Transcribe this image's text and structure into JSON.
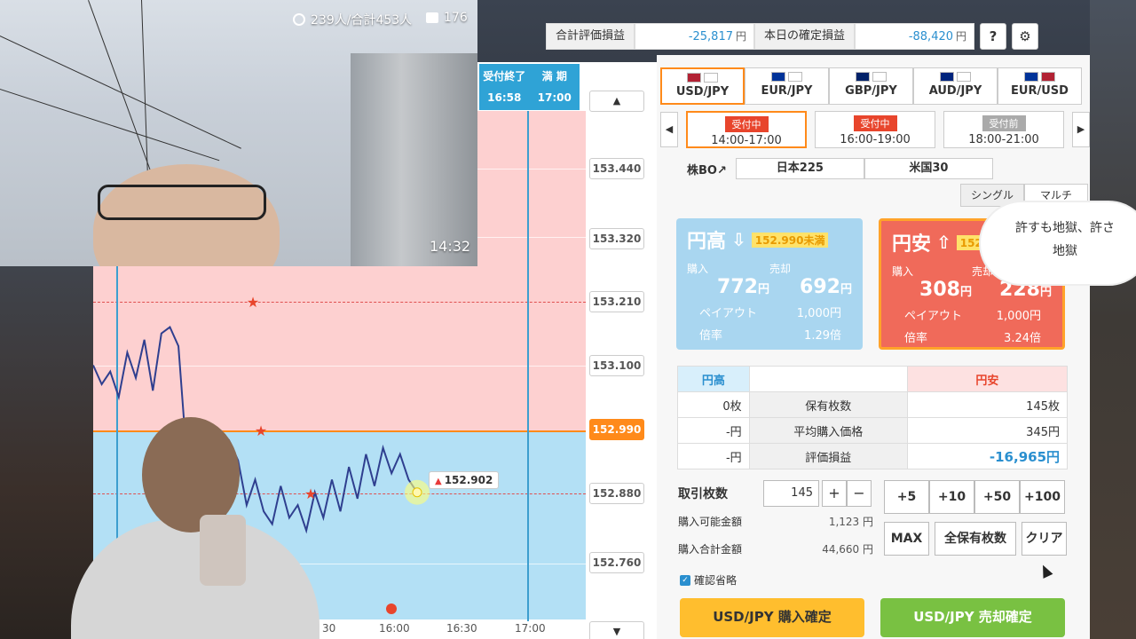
{
  "camera": {
    "viewers": "239人/合計453人",
    "comments": "176",
    "time": "14:32"
  },
  "topbar": {
    "total_eval_label": "合計評価損益",
    "total_eval_value": "-25,817",
    "today_confirmed_label": "本日の確定損益",
    "today_confirmed_value": "-88,420",
    "yen": "円",
    "help_label": "?",
    "settings_icon": "gear-icon"
  },
  "pairs": [
    {
      "label": "USD/JPY",
      "active": true
    },
    {
      "label": "EUR/JPY",
      "active": false
    },
    {
      "label": "GBP/JPY",
      "active": false
    },
    {
      "label": "AUD/JPY",
      "active": false
    },
    {
      "label": "EUR/USD",
      "active": false
    }
  ],
  "slots": [
    {
      "status": "受付中",
      "time": "14:00-17:00",
      "active": true
    },
    {
      "status": "受付中",
      "time": "16:00-19:00",
      "active": false
    },
    {
      "status": "受付前",
      "time": "18:00-21:00",
      "active": false
    }
  ],
  "stock": {
    "label": "株BO↗",
    "items": [
      "日本225",
      "米国30"
    ]
  },
  "mode_tabs": [
    "シングル",
    "マルチ"
  ],
  "chart": {
    "deadline_label": "受付終了",
    "deadline_time": "16:58",
    "expiry_label": "満 期",
    "expiry_time": "17:00",
    "price_ticks": [
      "153.440",
      "153.320",
      "153.210",
      "153.100",
      "152.990",
      "152.880",
      "152.760"
    ],
    "current_price": "152.990",
    "callout_price": "152.902",
    "time_ticks": [
      "30",
      "16:00",
      "16:30",
      "17:00"
    ],
    "up_arrow": "▲",
    "down_arrow": "▼"
  },
  "chart_data": {
    "type": "line",
    "series": [
      {
        "values": [
          153.1,
          153.07,
          153.09,
          153.05,
          153.12,
          153.08,
          153.14,
          153.06,
          153.15,
          153.16,
          153.13,
          152.95,
          152.97,
          152.92,
          152.96,
          152.93,
          152.98,
          152.95,
          152.88,
          152.92,
          152.87,
          152.85,
          152.91,
          152.86,
          152.88,
          152.84,
          152.9,
          152.86,
          152.92,
          152.87,
          152.94,
          152.89,
          152.96,
          152.91,
          152.97,
          152.93,
          152.96,
          152.92,
          152.9
        ]
      }
    ],
    "ylim": [
      152.7,
      153.5
    ],
    "strike": 152.99
  },
  "cards": {
    "high": {
      "title": "円高",
      "arrow": "⇩",
      "condition": "152.990未満",
      "buy_label": "購入",
      "sell_label": "売却",
      "buy_price": "772",
      "sell_price": "692",
      "payout_label": "ペイアウト",
      "payout_value": "1,000円",
      "rate_label": "倍率",
      "rate_value": "1.29倍"
    },
    "low": {
      "title": "円安",
      "arrow": "⇧",
      "condition": "152.990超",
      "buy_label": "購入",
      "sell_label": "売却",
      "buy_price": "308",
      "sell_price": "228",
      "payout_label": "ペイアウト",
      "payout_value": "1,000円",
      "rate_label": "倍率",
      "rate_value": "3.24倍"
    },
    "yen": "円"
  },
  "stats": {
    "header_high": "円高",
    "header_low": "円安",
    "rows": [
      {
        "label": "保有枚数",
        "high": "0枚",
        "low": "145枚"
      },
      {
        "label": "平均購入価格",
        "high": "-円",
        "low": "345円"
      },
      {
        "label": "評価損益",
        "high": "-円",
        "low": "-16,965円"
      }
    ]
  },
  "order": {
    "qty_label": "取引枚数",
    "qty_value": "145",
    "plus": "+",
    "minus": "−",
    "increments": [
      "+5",
      "+10",
      "+50",
      "+100"
    ],
    "max_label": "MAX",
    "all_label": "全保有枚数",
    "clear_label": "クリア",
    "available_label": "購入可能金額",
    "available_value": "1,123 円",
    "total_label": "購入合計金額",
    "total_value": "44,660 円",
    "confirm_skip": "確認省略",
    "buy_button": "USD/JPY 購入確定",
    "sell_button": "USD/JPY 売却確定"
  },
  "overlay": {
    "cloud_line1": "許すも地獄、許さ",
    "cloud_line2": "地獄"
  },
  "colors": {
    "accent_orange": "#ff8a1a",
    "pink_zone": "#fdd0d0",
    "blue_zone": "#b3e0f5",
    "series_line": "#2f3f8f"
  }
}
